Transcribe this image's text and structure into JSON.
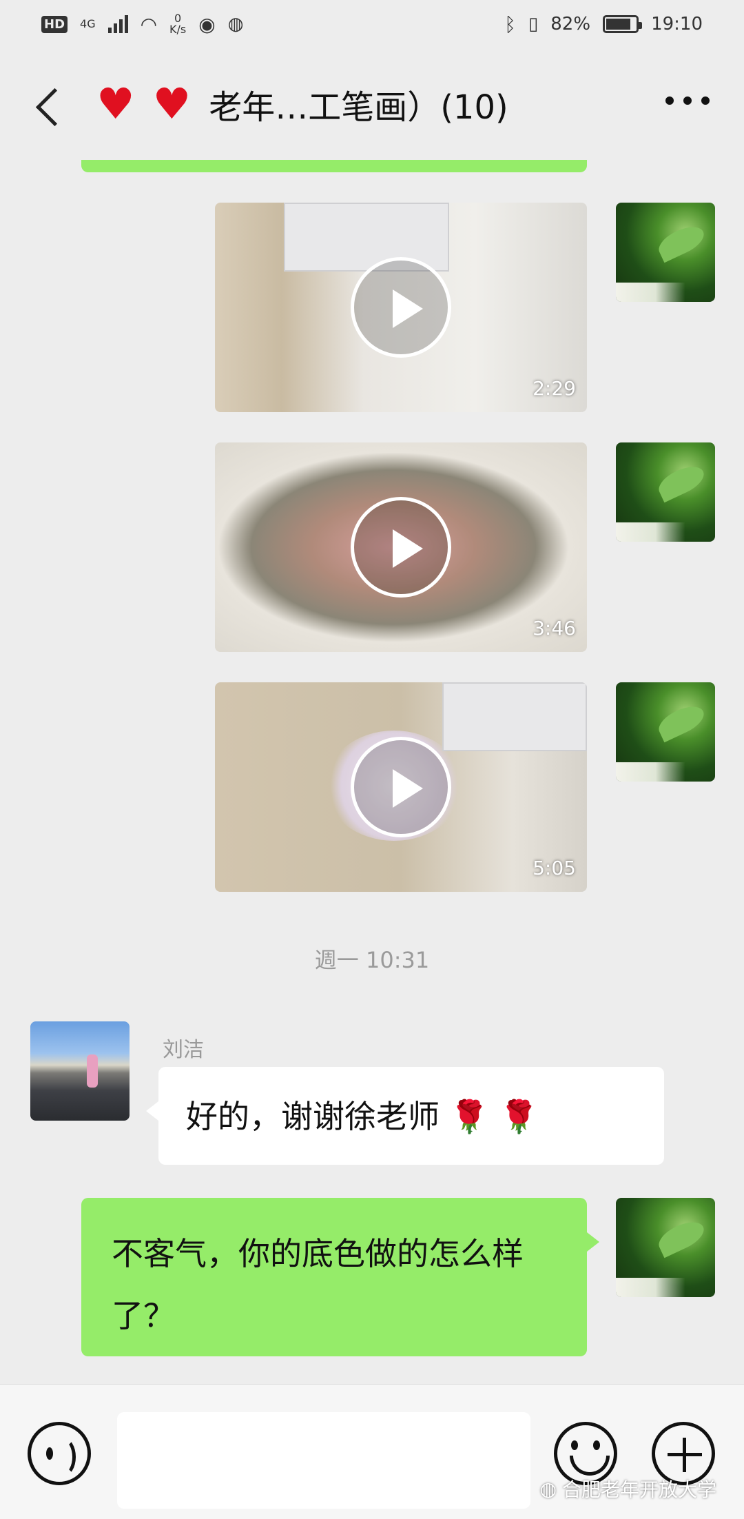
{
  "status": {
    "hd": "HD",
    "network": "4G",
    "speed_value": "0",
    "speed_unit": "K/s",
    "battery": "82%",
    "time": "19:10"
  },
  "header": {
    "title": "老年…工笔画）(10)"
  },
  "videos": [
    {
      "duration": "2:29"
    },
    {
      "duration": "3:46"
    },
    {
      "duration": "5:05"
    }
  ],
  "timestamp": "週一 10:31",
  "messages": {
    "incoming": {
      "sender": "刘洁",
      "text": "好的，谢谢徐老师",
      "emoji": "🌹 🌹"
    },
    "outgoing": {
      "text": "不客气，你的底色做的怎么样了？"
    }
  },
  "watermark": "合肥老年开放大学",
  "colors": {
    "bubble_green": "#95ec69",
    "background": "#ededed"
  }
}
